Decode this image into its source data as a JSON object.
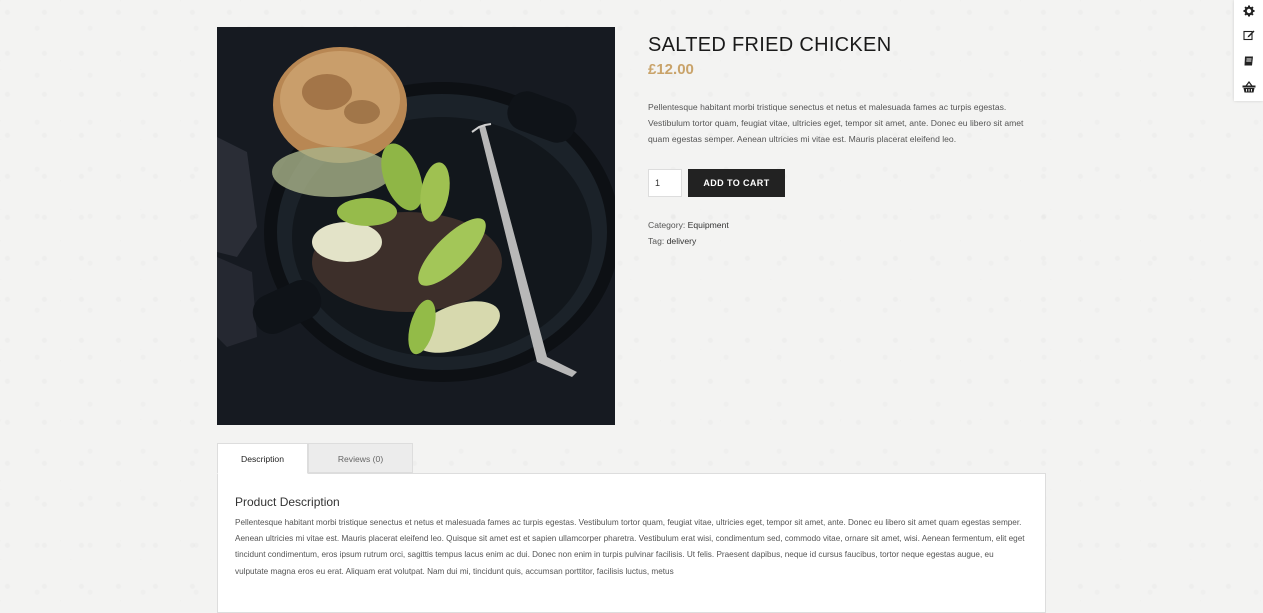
{
  "product": {
    "title": "SALTED FRIED CHICKEN",
    "price": "£12.00",
    "short_description": "Pellentesque habitant morbi tristique senectus et netus et malesuada fames ac turpis egestas. Vestibulum tortor quam, feugiat vitae, ultricies eget, tempor sit amet, ante. Donec eu libero sit amet quam egestas semper. Aenean ultricies mi vitae est. Mauris placerat eleifend leo.",
    "quantity": "1",
    "add_to_cart_label": "ADD TO CART",
    "category_label": "Category:",
    "category_value": "Equipment",
    "tag_label": "Tag:",
    "tag_value": "delivery",
    "image_icon": "food-photo-burger-avocado-skillet"
  },
  "tabs": [
    {
      "label": "Description",
      "active": true
    },
    {
      "label": "Reviews (0)",
      "active": false
    }
  ],
  "panel": {
    "heading": "Product Description",
    "text": "Pellentesque habitant morbi tristique senectus et netus et malesuada fames ac turpis egestas. Vestibulum tortor quam, feugiat vitae, ultricies eget, tempor sit amet, ante. Donec eu libero sit amet quam egestas semper. Aenean ultricies mi vitae est. Mauris placerat eleifend leo. Quisque sit amet est et sapien ullamcorper pharetra. Vestibulum erat wisi, condimentum sed, commodo vitae, ornare sit amet, wisi. Aenean fermentum, elit eget tincidunt condimentum, eros ipsum rutrum orci, sagittis tempus lacus enim ac dui. Donec non enim in turpis pulvinar facilisis. Ut felis. Praesent dapibus, neque id cursus faucibus, tortor neque egestas augue, eu vulputate magna eros eu erat. Aliquam erat volutpat. Nam dui mi, tincidunt quis, accumsan porttitor, facilisis luctus, metus"
  },
  "side_toolbar": {
    "icons": [
      "gear-icon",
      "edit-icon",
      "book-icon",
      "basket-icon"
    ]
  },
  "colors": {
    "price": "#c9a36a",
    "button_bg": "#222222",
    "button_text": "#ffffff",
    "page_bg": "#f3f3f2"
  }
}
